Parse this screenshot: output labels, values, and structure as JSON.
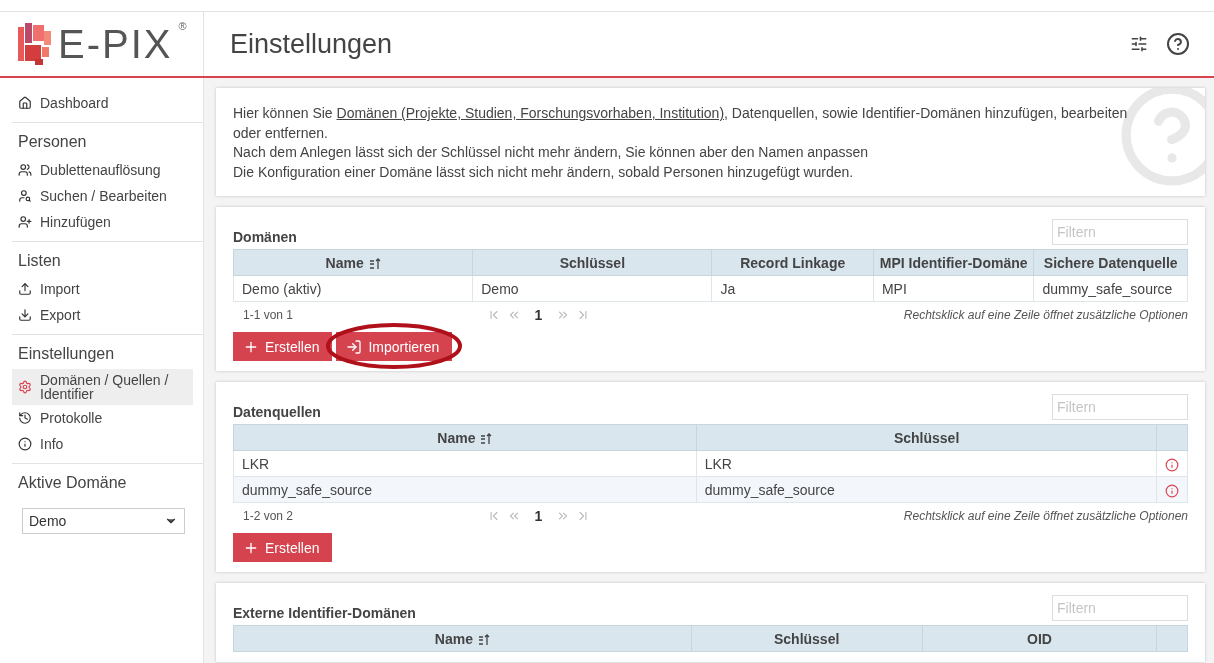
{
  "logo": {
    "name": "E-PIX",
    "mark": "®"
  },
  "header": {
    "title": "Einstellungen"
  },
  "sidebar": {
    "top": [
      {
        "label": "Dashboard",
        "selected": false
      }
    ],
    "sections": [
      {
        "title": "Personen",
        "items": [
          {
            "label": "Dublettenauflösung",
            "selected": false
          },
          {
            "label": "Suchen / Bearbeiten",
            "selected": false
          },
          {
            "label": "Hinzufügen",
            "selected": false
          }
        ]
      },
      {
        "title": "Listen",
        "items": [
          {
            "label": "Import",
            "selected": false
          },
          {
            "label": "Export",
            "selected": false
          }
        ]
      },
      {
        "title": "Einstellungen",
        "items": [
          {
            "label": "Domänen / Quellen / Identifier",
            "selected": true
          },
          {
            "label": "Protokolle",
            "selected": false
          },
          {
            "label": "Info",
            "selected": false
          }
        ]
      }
    ],
    "active_domain": {
      "title": "Aktive Domäne",
      "value": "Demo"
    }
  },
  "intro": {
    "lead": "Hier können Sie ",
    "link": "Domänen (Projekte, Studien, Forschungsvorhaben, Institution)",
    "rest": ", Datenquellen, sowie Identifier-Domänen hinzufügen, bearbeiten oder entfernen.",
    "notes": [
      "Nach dem Anlegen lässt sich der Schlüssel nicht mehr ändern, Sie können aber den Namen anpassen",
      "Die Konfiguration einer Domäne lässt sich nicht mehr ändern, sobald Personen hinzugefügt wurden."
    ]
  },
  "panels": [
    {
      "title": "Domänen",
      "filter_placeholder": "Filtern",
      "columns": [
        {
          "label": "Name",
          "sorted": true
        },
        {
          "label": "Schlüssel",
          "sorted": false
        },
        {
          "label": "Record Linkage",
          "sorted": false
        },
        {
          "label": "MPI Identifier-Domäne",
          "sorted": false
        },
        {
          "label": "Sichere Datenquelle",
          "sorted": false
        }
      ],
      "info_column": false,
      "rows": [
        [
          "Demo (aktiv)",
          "Demo",
          "Ja",
          "MPI",
          "dummy_safe_source"
        ]
      ],
      "count": "1-1 von 1",
      "page": "1",
      "hint": "Rechtsklick auf eine Zeile öffnet zusätzliche Optionen",
      "buttons": [
        {
          "kind": "create",
          "label": "Erstellen",
          "highlighted": false
        },
        {
          "kind": "import",
          "label": "Importieren",
          "highlighted": true
        }
      ]
    },
    {
      "title": "Datenquellen",
      "filter_placeholder": "Filtern",
      "columns": [
        {
          "label": "Name",
          "sorted": true
        },
        {
          "label": "Schlüssel",
          "sorted": false
        }
      ],
      "info_column": true,
      "rows": [
        [
          "LKR",
          "LKR"
        ],
        [
          "dummy_safe_source",
          "dummy_safe_source"
        ]
      ],
      "count": "1-2 von 2",
      "page": "1",
      "hint": "Rechtsklick auf eine Zeile öffnet zusätzliche Optionen",
      "buttons": [
        {
          "kind": "create",
          "label": "Erstellen",
          "highlighted": false
        }
      ]
    },
    {
      "title": "Externe Identifier-Domänen",
      "filter_placeholder": "Filtern",
      "columns": [
        {
          "label": "Name",
          "sorted": true
        },
        {
          "label": "Schlüssel",
          "sorted": false
        },
        {
          "label": "OID",
          "sorted": false
        }
      ],
      "info_column": true
    }
  ]
}
